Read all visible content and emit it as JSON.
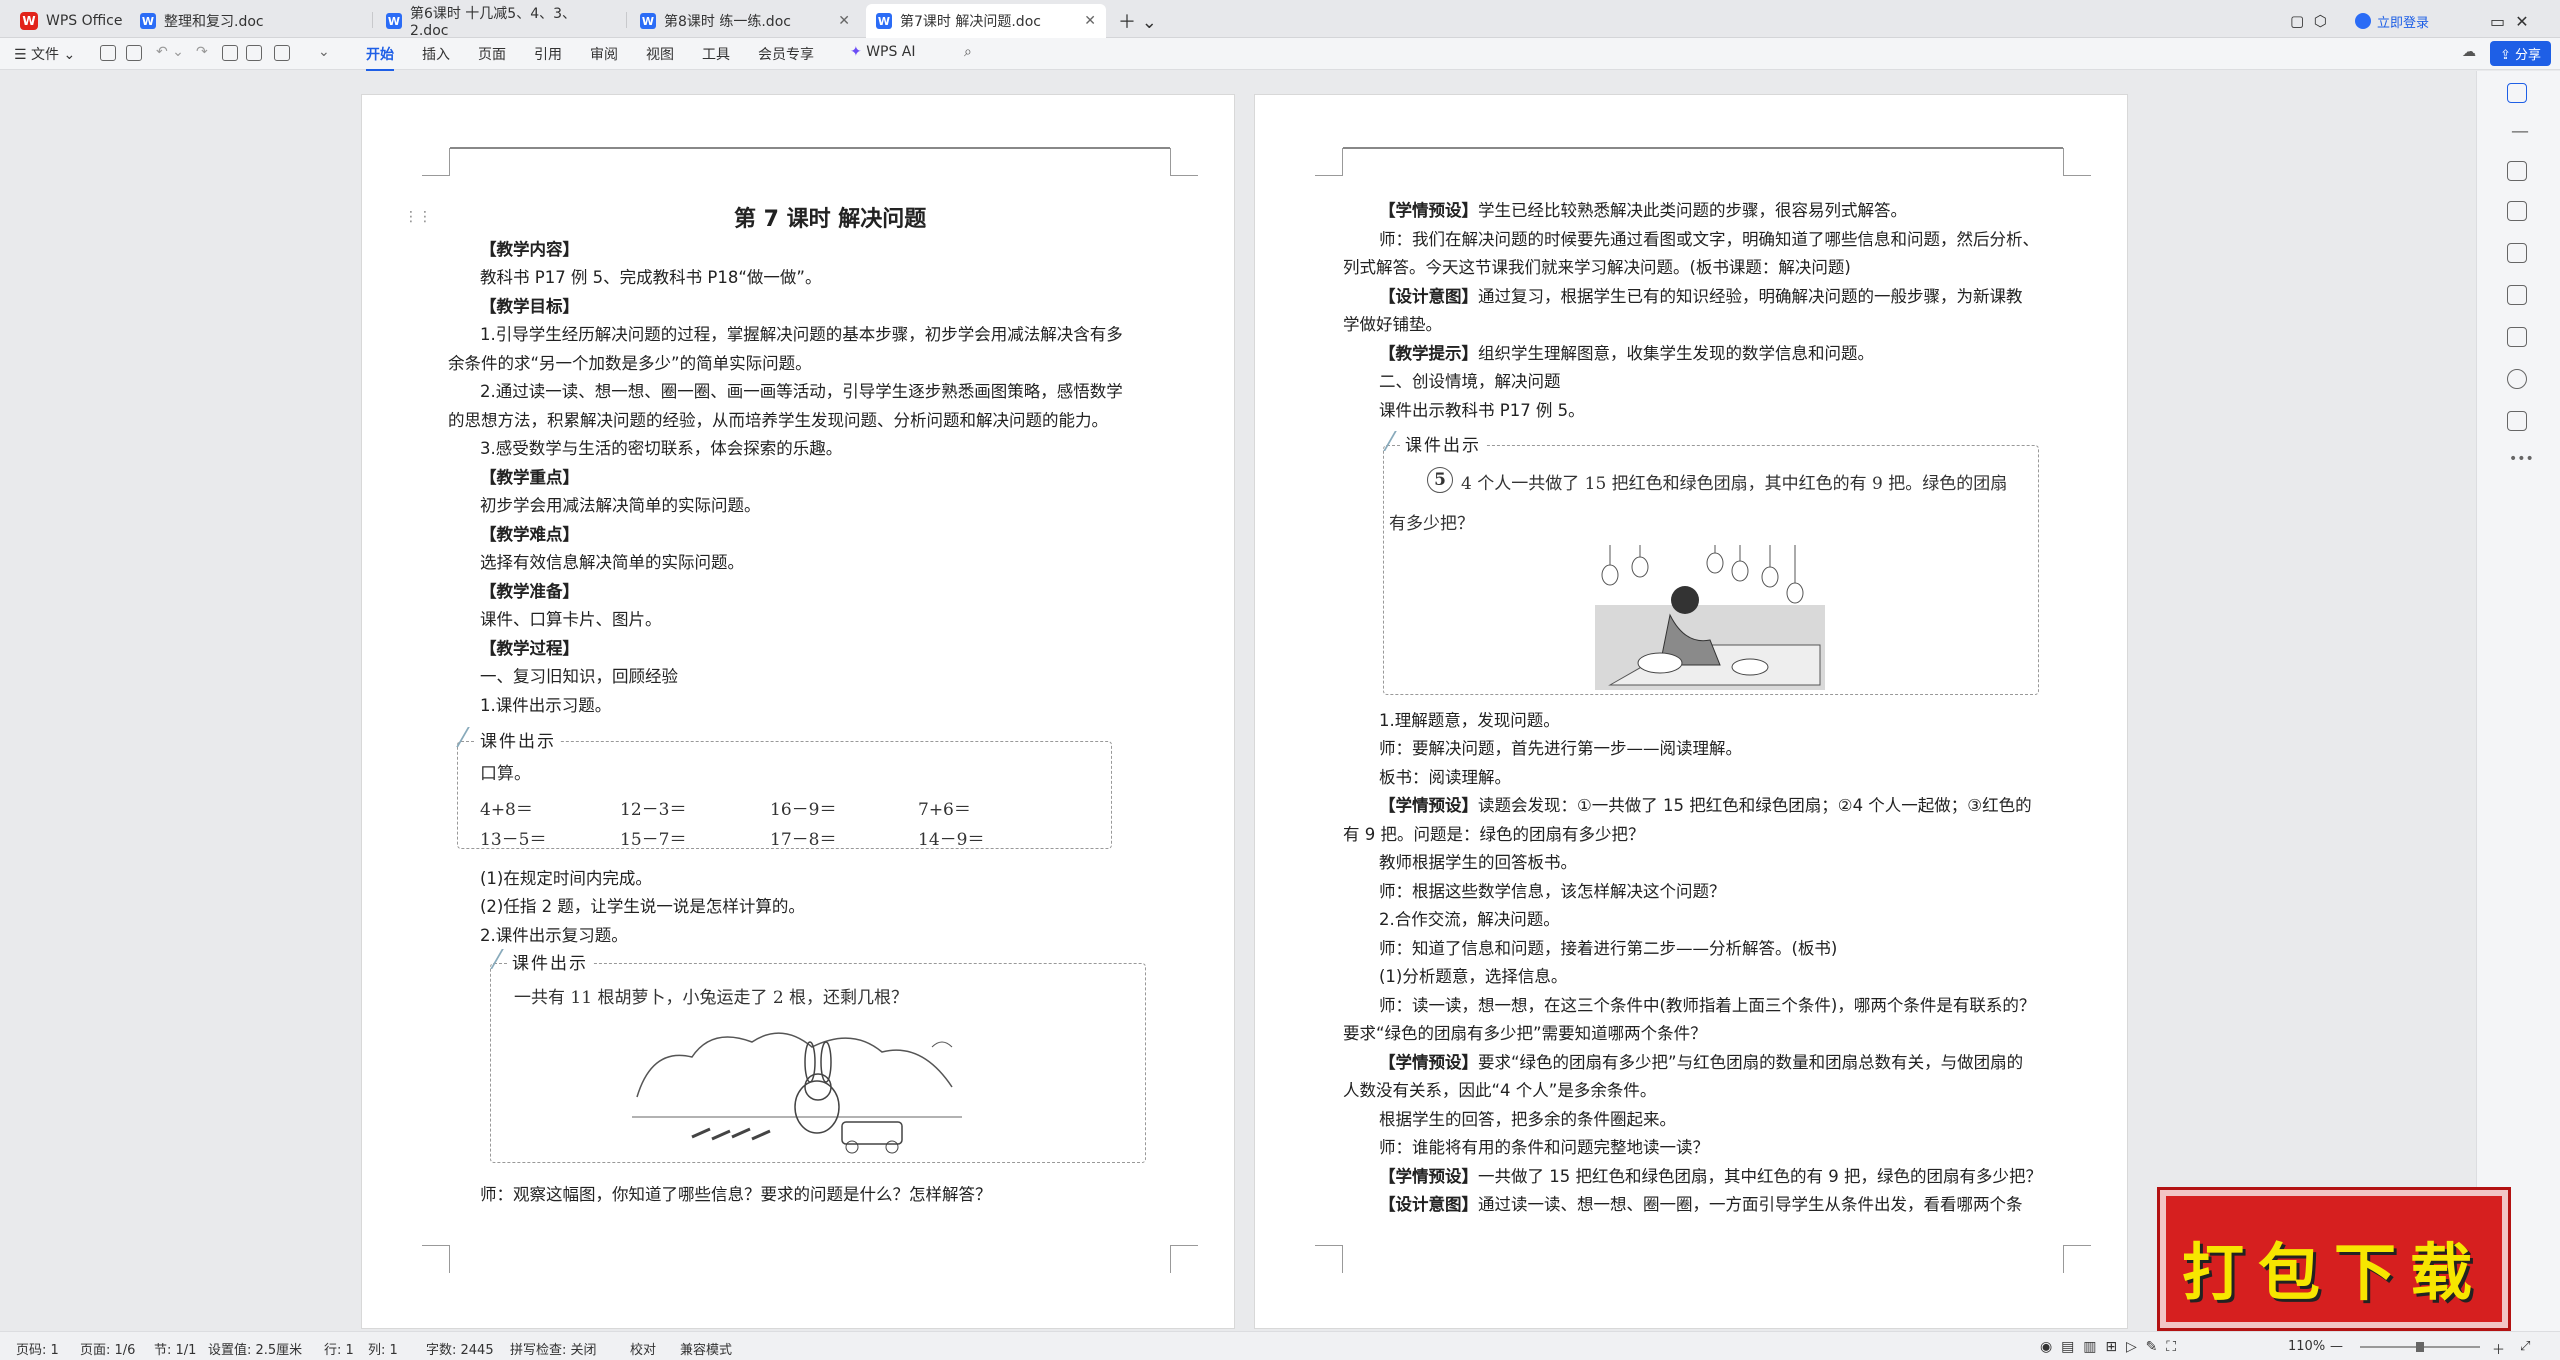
{
  "tabs": {
    "app": "WPS Office",
    "t1": "整理和复习.doc",
    "t2": "第6课时 十几减5、4、3、2.doc",
    "t3": "第8课时 练一练.doc",
    "t4": "第7课时 解决问题.doc",
    "login": "立即登录"
  },
  "menu": {
    "file": "文件",
    "start": "开始",
    "insert": "插入",
    "page": "页面",
    "ref": "引用",
    "review": "审阅",
    "view": "视图",
    "tools": "工具",
    "vip": "会员专享",
    "ai": "WPS AI",
    "share": "分享"
  },
  "left": {
    "title": "第 7 课时  解决问题",
    "h1": "【教学内容】",
    "l1": "教科书 P17 例 5、完成教科书 P18“做一做”。",
    "h2": "【教学目标】",
    "l2a": "1.引导学生经历解决问题的过程，掌握解决问题的基本步骤，初步学会用减法解决含有多",
    "l2b": "余条件的求“另一个加数是多少”的简单实际问题。",
    "l3a": "2.通过读一读、想一想、圈一圈、画一画等活动，引导学生逐步熟悉画图策略，感悟数学",
    "l3b": "的思想方法，积累解决问题的经验，从而培养学生发现问题、分析问题和解决问题的能力。",
    "l4": "3.感受数学与生活的密切联系，体会探索的乐趣。",
    "h3": "【教学重点】",
    "l5": "初步学会用减法解决简单的实际问题。",
    "h4": "【教学难点】",
    "l6": "选择有效信息解决简单的实际问题。",
    "h5": "【教学准备】",
    "l7": "课件、口算卡片、图片。",
    "h6": "【教学过程】",
    "l8": "一、复习旧知识，回顾经验",
    "l9": "1.课件出示习题。",
    "box1_title": "课件出示",
    "box1_head": "口算。",
    "calc": [
      "4+8＝",
      "12－3＝",
      "16－9＝",
      "7+6＝",
      "13－5＝",
      "15－7＝",
      "17－8＝",
      "14－9＝"
    ],
    "l10": "(1)在规定时间内完成。",
    "l11": "(2)任指 2 题，让学生说一说是怎样计算的。",
    "l12": "2.课件出示复习题。",
    "box2_title": "课件出示",
    "box2_text": "一共有 11 根胡萝卜，小兔运走了 2 根，还剩几根？",
    "l13": "师：观察这幅图，你知道了哪些信息？要求的问题是什么？怎样解答？"
  },
  "right": {
    "r1a": "【学情预设】",
    "r1b": "学生已经比较熟悉解决此类问题的步骤，很容易列式解答。",
    "r2a": "师：我们在解决问题的时候要先通过看图或文字，明确知道了哪些信息和问题，然后分析、",
    "r2b": "列式解答。今天这节课我们就来学习解决问题。(板书课题：解决问题)",
    "r3a": "【设计意图】",
    "r3b": "通过复习，根据学生已有的知识经验，明确解决问题的一般步骤，为新课教",
    "r3c": "学做好铺垫。",
    "r4a": "【教学提示】",
    "r4b": "组织学生理解图意，收集学生发现的数学信息和问题。",
    "r5": "二、创设情境，解决问题",
    "r6": "课件出示教科书 P17 例 5。",
    "box3_title": "课件出示",
    "box3_num": "5",
    "box3_l1": "4 个人一共做了 15 把红色和绿色团扇，其中红色的有 9 把。绿色的团扇",
    "box3_l2": "有多少把？",
    "r7": "1.理解题意，发现问题。",
    "r8": "师：要解决问题，首先进行第一步——阅读理解。",
    "r9": "板书：阅读理解。",
    "r10a": "【学情预设】",
    "r10b": "读题会发现：①一共做了 15 把红色和绿色团扇；②4 个人一起做；③红色的",
    "r10c": "有 9 把。问题是：绿色的团扇有多少把？",
    "r11": "教师根据学生的回答板书。",
    "r12": "师：根据这些数学信息，该怎样解决这个问题？",
    "r13": "2.合作交流，解决问题。",
    "r14": "师：知道了信息和问题，接着进行第二步——分析解答。(板书)",
    "r15": "(1)分析题意，选择信息。",
    "r16a": "师：读一读，想一想，在这三个条件中(教师指着上面三个条件)，哪两个条件是有联系的？",
    "r16b": "要求“绿色的团扇有多少把”需要知道哪两个条件？",
    "r17a": "【学情预设】",
    "r17b": "要求“绿色的团扇有多少把”与红色团扇的数量和团扇总数有关，与做团扇的",
    "r17c": "人数没有关系，因此“4 个人”是多余条件。",
    "r18": "根据学生的回答，把多余的条件圈起来。",
    "r19": "师：谁能将有用的条件和问题完整地读一读？",
    "r20a": "【学情预设】",
    "r20b": "一共做了 15 把红色和绿色团扇，其中红色的有 9 把，绿色的团扇有多少把？",
    "r21a": "【设计意图】",
    "r21b": "通过读一读、想一想、圈一圈，一方面引导学生从条件出发，看看哪两个条"
  },
  "status": {
    "page": "页码: 1",
    "pages": "页面: 1/6",
    "section": "节: 1/1",
    "setting": "设置值: 2.5厘米",
    "row": "行: 1",
    "col": "列: 1",
    "words": "字数: 2445",
    "spell": "拼写检查: 关闭",
    "proof": "校对",
    "compat": "兼容模式",
    "zoom": "110%"
  },
  "promo": {
    "text": "打包下载"
  }
}
